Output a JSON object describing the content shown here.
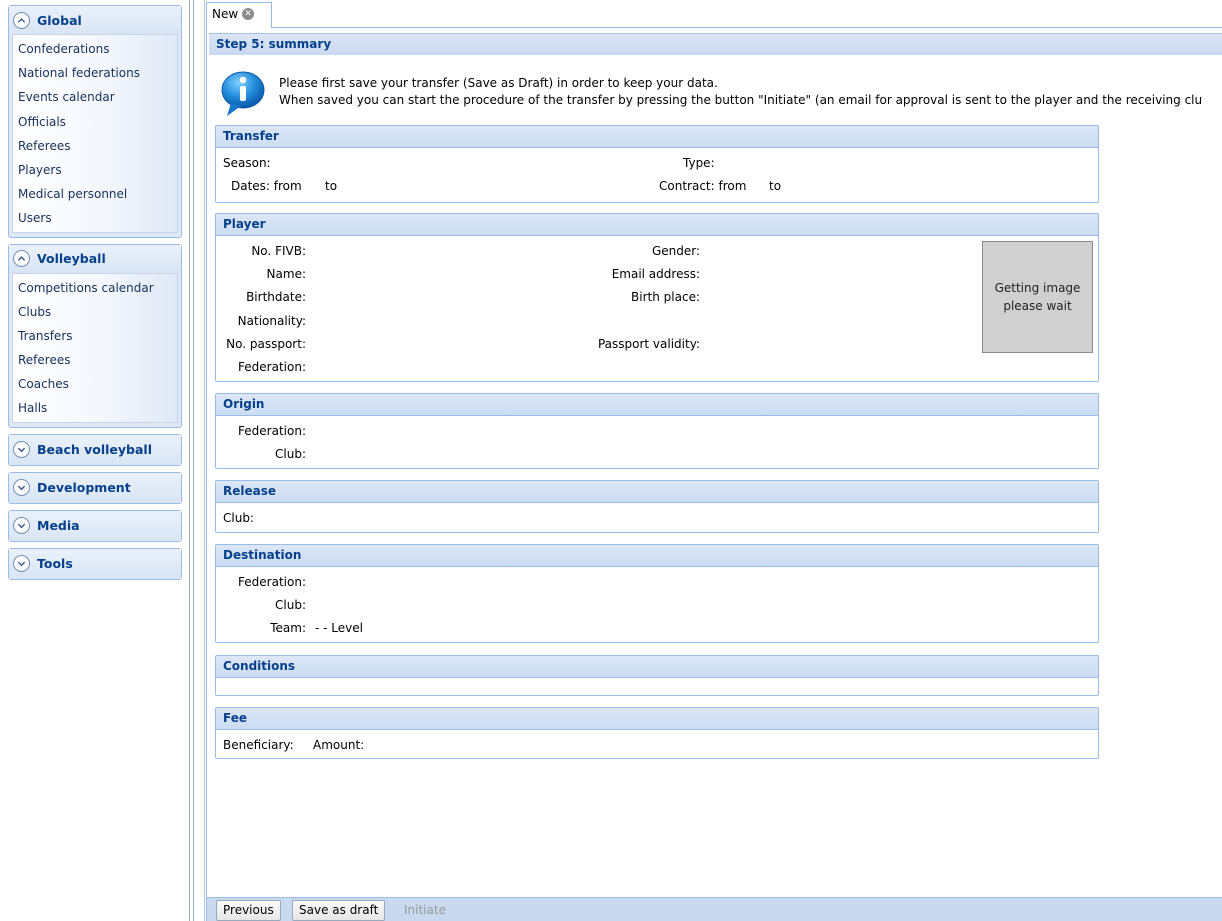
{
  "sidebar": {
    "groups": [
      {
        "title": "Global",
        "expanded": true,
        "items": [
          "Confederations",
          "National federations",
          "Events calendar",
          "Officials",
          "Referees",
          "Players",
          "Medical personnel",
          "Users"
        ]
      },
      {
        "title": "Volleyball",
        "expanded": true,
        "items": [
          "Competitions calendar",
          "Clubs",
          "Transfers",
          "Referees",
          "Coaches",
          "Halls"
        ]
      },
      {
        "title": "Beach volleyball",
        "expanded": false
      },
      {
        "title": "Development",
        "expanded": false
      },
      {
        "title": "Media",
        "expanded": false
      },
      {
        "title": "Tools",
        "expanded": false
      }
    ]
  },
  "tabs": [
    {
      "label": "New"
    }
  ],
  "step": {
    "title": "Step 5: summary"
  },
  "info": {
    "line1": "Please first save your transfer (Save as Draft) in order to keep your data.",
    "line2": "When saved you can start the procedure of the transfer by pressing the button \"Initiate\" (an email for approval is sent to the player and the receiving clu"
  },
  "transfer": {
    "title": "Transfer",
    "season_label": "Season:",
    "type_label": "Type:",
    "dates_label": "Dates: from",
    "dates_to": "to",
    "contract_label": "Contract: from",
    "contract_to": "to"
  },
  "player": {
    "title": "Player",
    "fivb_label": "No. FIVB:",
    "name_label": "Name:",
    "birthdate_label": "Birthdate:",
    "nationality_label": "Nationality:",
    "passport_label": "No. passport:",
    "federation_label": "Federation:",
    "gender_label": "Gender:",
    "email_label": "Email address:",
    "birthplace_label": "Birth place:",
    "passport_validity_label": "Passport validity:",
    "photo_line1": "Getting image",
    "photo_line2": "please wait"
  },
  "origin": {
    "title": "Origin",
    "federation_label": "Federation:",
    "club_label": "Club:"
  },
  "release": {
    "title": "Release",
    "club_label": "Club:"
  },
  "destination": {
    "title": "Destination",
    "federation_label": "Federation:",
    "club_label": "Club:",
    "team_label": "Team:",
    "team_value": "- - Level"
  },
  "conditions": {
    "title": "Conditions"
  },
  "fee": {
    "title": "Fee",
    "beneficiary_label": "Beneficiary:",
    "amount_label": "Amount:"
  },
  "toolbar": {
    "previous": "Previous",
    "save_draft": "Save as draft",
    "initiate": "Initiate"
  },
  "colors": {
    "accent": "#04408c",
    "border": "#99bce8",
    "header_bg": "#dce7f7"
  }
}
